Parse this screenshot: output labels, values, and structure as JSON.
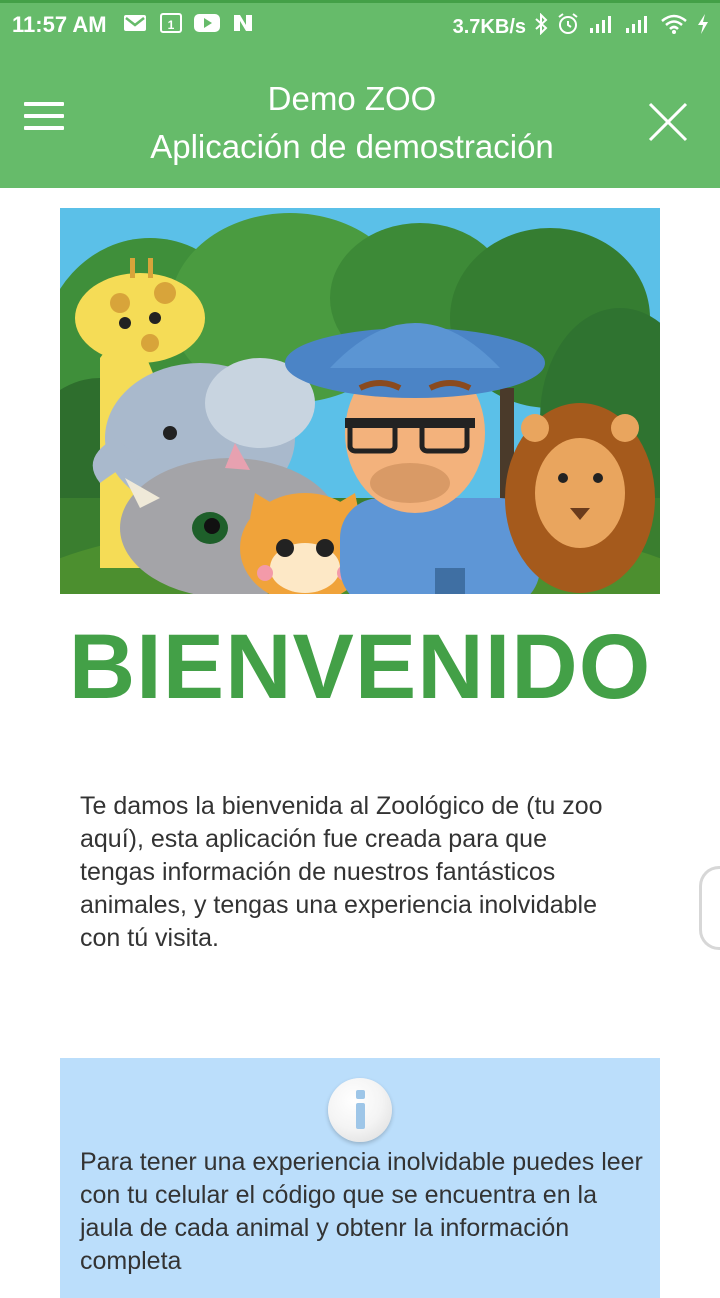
{
  "status_bar": {
    "time": "11:57 AM",
    "net_speed": "3.7KB/s",
    "icons_left": [
      "gmail-icon",
      "calendar-icon",
      "youtube-icon",
      "n-app-icon"
    ],
    "icons_right": [
      "bluetooth-icon",
      "alarm-icon",
      "signal-icon",
      "signal-icon",
      "wifi-icon",
      "charging-icon"
    ]
  },
  "appbar": {
    "title": "Demo ZOO",
    "subtitle": "Aplicación de demostración",
    "menu_icon": "hamburger-menu-icon",
    "close_icon": "close-icon",
    "color": "#66BB6A"
  },
  "hero": {
    "image": "zoo-keeper-with-animals-illustration"
  },
  "welcome": {
    "heading": "BIENVENIDO",
    "color": "#43A047"
  },
  "intro": {
    "text": "Te damos la bienvenida al Zoológico de (tu zoo aquí), esta aplicación fue creada para que tengas información de nuestros fantásticos animales, y tengas una experiencia inolvidable con tú visita."
  },
  "info": {
    "icon": "info-icon",
    "text": "Para tener una experiencia inolvidable puedes leer con tu celular el código que se encuentra en la jaula de cada animal y obtenr la información completa",
    "background": "#BBDEFB"
  }
}
